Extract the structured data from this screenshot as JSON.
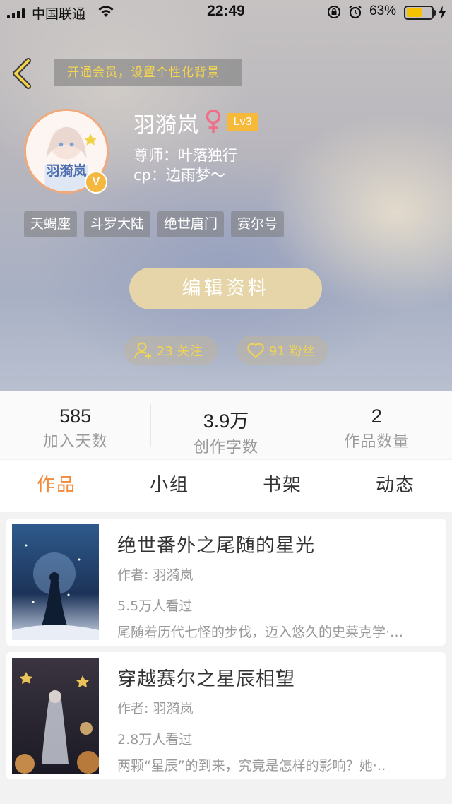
{
  "status_bar": {
    "carrier": "中国联通",
    "time": "22:49",
    "battery_pct": "63%",
    "battery_level": 0.63,
    "icons": [
      "signal-icon",
      "wifi-icon",
      "orientation-lock-icon",
      "alarm-icon",
      "battery-icon",
      "charging-icon"
    ]
  },
  "header": {
    "vip_banner": "开通会员，设置个性化背景",
    "username": "羽漪岚",
    "level": "Lv3",
    "mentor": "尊师：叶落独行",
    "cp": "cp：边雨梦～",
    "verified_badge": "V",
    "tags": [
      "天蝎座",
      "斗罗大陆",
      "绝世唐门",
      "赛尔号"
    ],
    "edit_button": "编辑资料",
    "follow_label": "23 关注",
    "fans_label": "91 粉丝"
  },
  "stats": [
    {
      "value": "585",
      "label": "加入天数"
    },
    {
      "value": "3.9万",
      "label": "创作字数"
    },
    {
      "value": "2",
      "label": "作品数量"
    }
  ],
  "tabs": [
    "作品",
    "小组",
    "书架",
    "动态"
  ],
  "active_tab": "作品",
  "books": [
    {
      "title": "绝世番外之尾随的星光",
      "author": "作者: 羽漪岚",
      "views": "5.5万人看过",
      "desc": "尾随着历代七怪的步伐，迈入悠久的史莱克学·…"
    },
    {
      "title": "穿越赛尔之星辰相望",
      "author": "作者: 羽漪岚",
      "views": "2.8万人看过",
      "desc": "两颗“星辰”的到来，究竟是怎样的影响？她·‥"
    }
  ],
  "colors": {
    "accent_orange": "#f08a3c",
    "gold_text": "#f2d44f",
    "level_badge": "#f6b93a",
    "edit_button": "#e5d5a8"
  }
}
